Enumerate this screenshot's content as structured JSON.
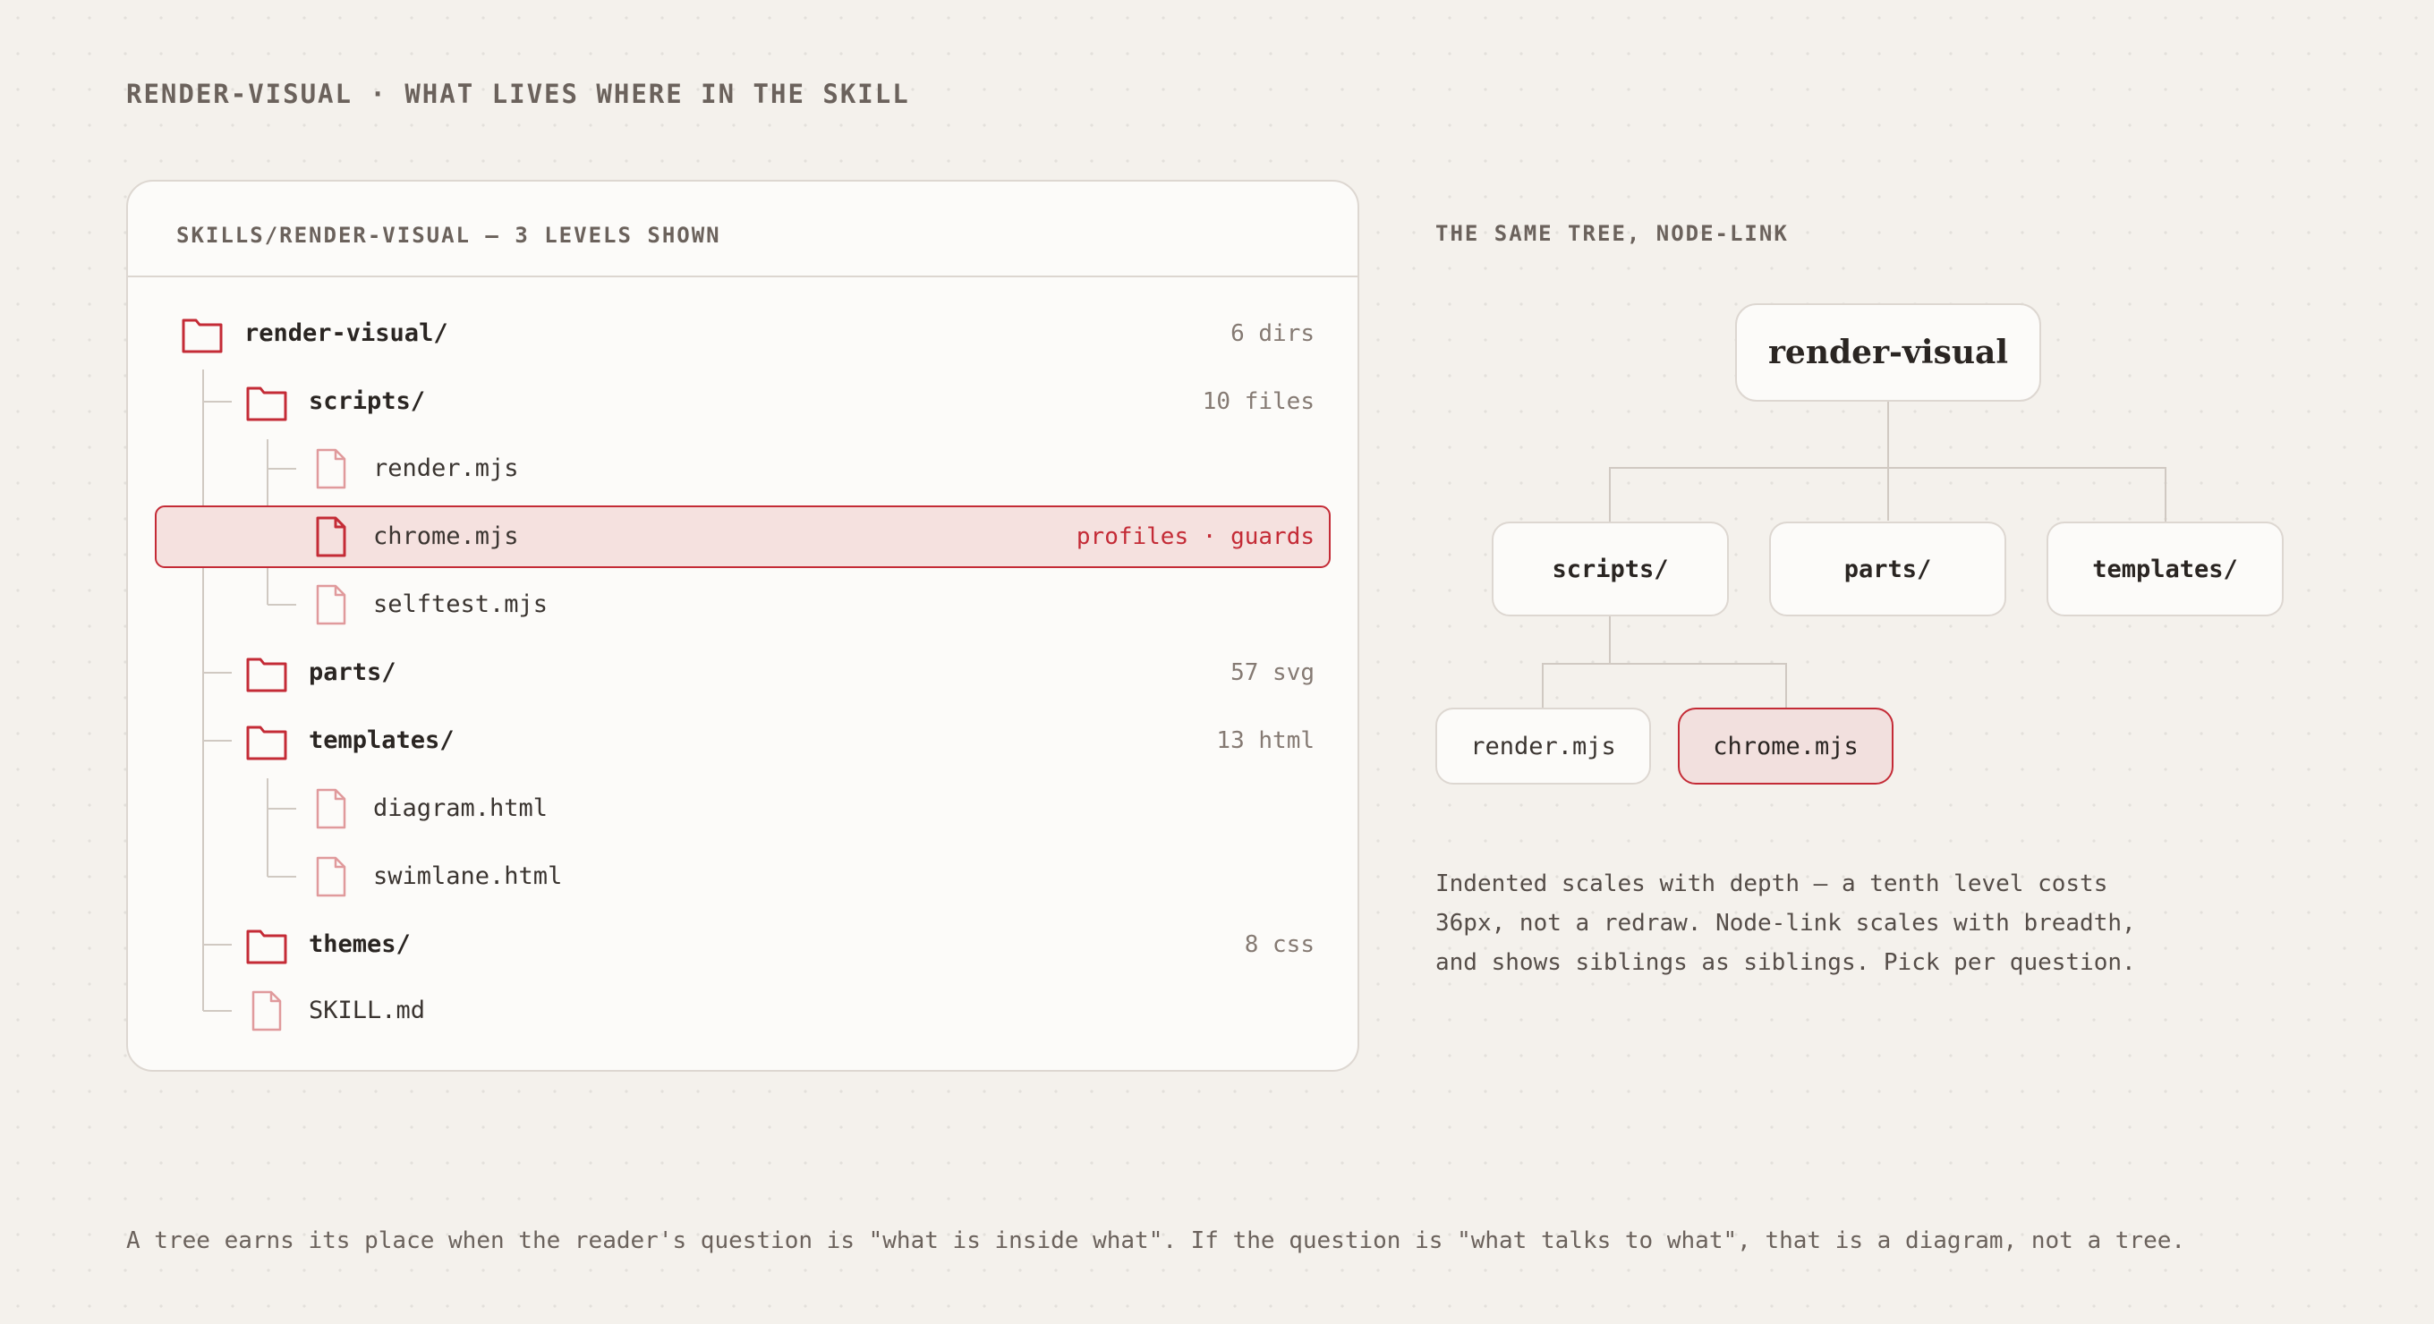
{
  "heading": "RENDER-VISUAL · WHAT LIVES WHERE IN THE SKILL",
  "panel": {
    "title": "SKILLS/RENDER-VISUAL — 3 LEVELS SHOWN",
    "rows": [
      {
        "label": "render-visual/",
        "meta": "6 dirs",
        "kind": "folder",
        "depth": 0
      },
      {
        "label": "scripts/",
        "meta": "10 files",
        "kind": "folder",
        "depth": 1
      },
      {
        "label": "render.mjs",
        "meta": "",
        "kind": "file",
        "depth": 2
      },
      {
        "label": "chrome.mjs",
        "meta": "profiles · guards",
        "kind": "file",
        "depth": 2,
        "highlighted": true
      },
      {
        "label": "selftest.mjs",
        "meta": "",
        "kind": "file",
        "depth": 2
      },
      {
        "label": "parts/",
        "meta": "57 svg",
        "kind": "folder",
        "depth": 1
      },
      {
        "label": "templates/",
        "meta": "13 html",
        "kind": "folder",
        "depth": 1
      },
      {
        "label": "diagram.html",
        "meta": "",
        "kind": "file",
        "depth": 2
      },
      {
        "label": "swimlane.html",
        "meta": "",
        "kind": "file",
        "depth": 2
      },
      {
        "label": "themes/",
        "meta": "8 css",
        "kind": "folder",
        "depth": 1
      },
      {
        "label": "SKILL.md",
        "meta": "",
        "kind": "file",
        "depth": 1
      }
    ]
  },
  "node_link": {
    "title": "THE SAME TREE, NODE-LINK",
    "root": "render-visual",
    "children": [
      "scripts/",
      "parts/",
      "templates/"
    ],
    "grandchildren": [
      "render.mjs",
      "chrome.mjs"
    ],
    "highlighted": "chrome.mjs"
  },
  "note": "Indented scales with depth — a tenth level costs 36px, not a redraw. Node-link scales with breadth, and shows siblings as siblings. Pick per question.",
  "footer": "A tree earns its place when the reader's question is \"what is inside what\". If the question is \"what talks to what\", that is a diagram, not a tree.",
  "colors": {
    "accent": "#c42b36",
    "accent_fill": "#f5e1df",
    "background": "#f4f1ec",
    "panel": "#fcfbf9",
    "muted_text": "#6b625c"
  }
}
